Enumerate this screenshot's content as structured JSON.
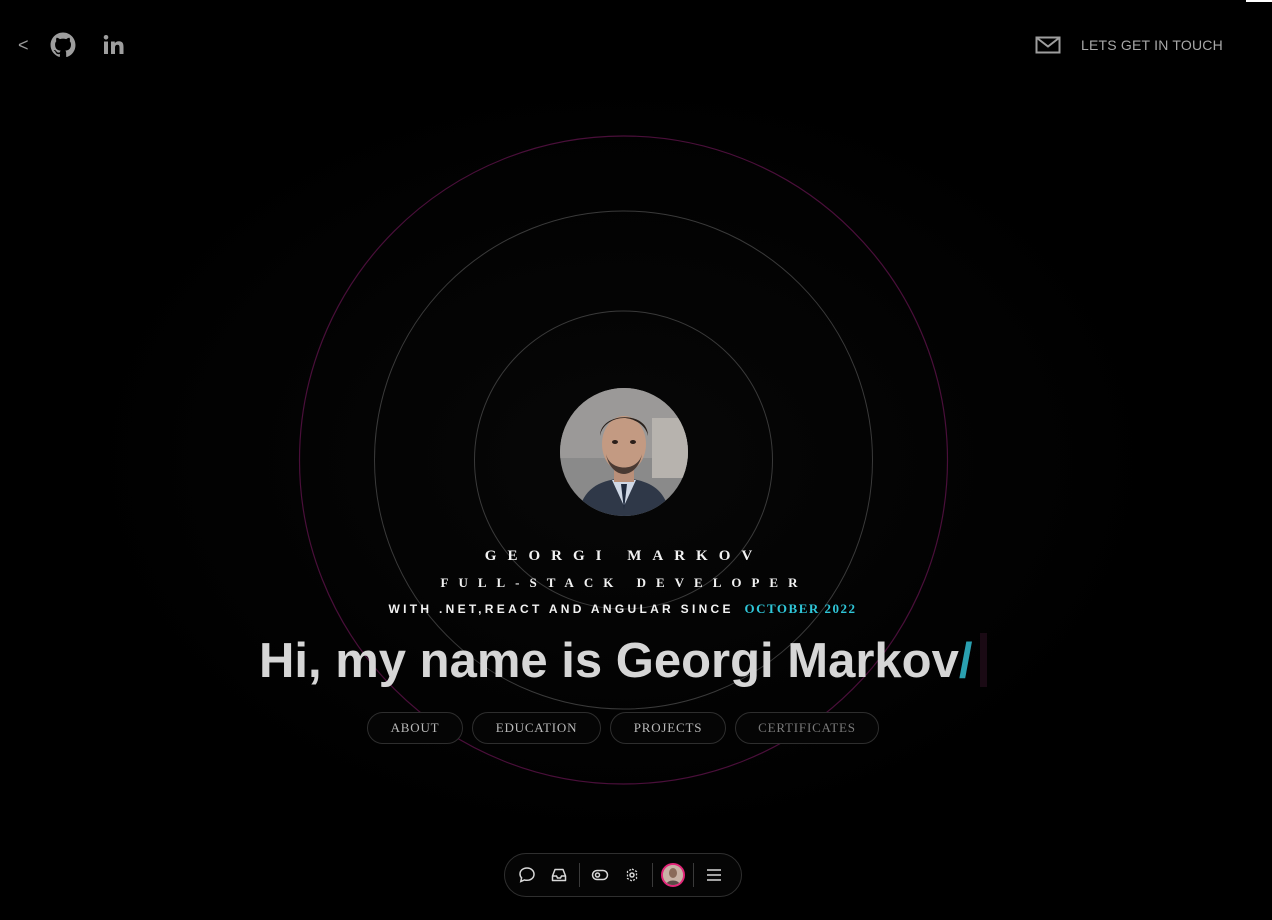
{
  "nav": {
    "back_label": "<",
    "icons": [
      "chevron-left-icon",
      "github-icon",
      "linkedin-icon"
    ],
    "contact_label": "LETS GET IN TOUCH",
    "contact_icon": "mail-icon"
  },
  "hero": {
    "name": "GEORGI MARKOV",
    "role": "FULL-STACK DEVELOPER",
    "since_text": "WITH .NET,REACT AND ANGULAR SINCE",
    "since_date": "OCTOBER 2022",
    "headline": "Hi, my name is Georgi Markov",
    "headline_suffix": "/"
  },
  "sections": {
    "about": "ABOUT",
    "education": "EDUCATION",
    "projects": "PROJECTS",
    "certificates": "CERTIFICATES"
  },
  "dock": {
    "icons": [
      "chat-bubble-icon",
      "inbox-icon",
      "toggle-eye-icon",
      "settings-target-icon",
      "user-avatar",
      "menu-icon"
    ]
  },
  "colors": {
    "background": "#000000",
    "accent": "#2fc6d8",
    "outer_ring": "#4a0f3a",
    "avatar_ring": "#e3267a"
  }
}
